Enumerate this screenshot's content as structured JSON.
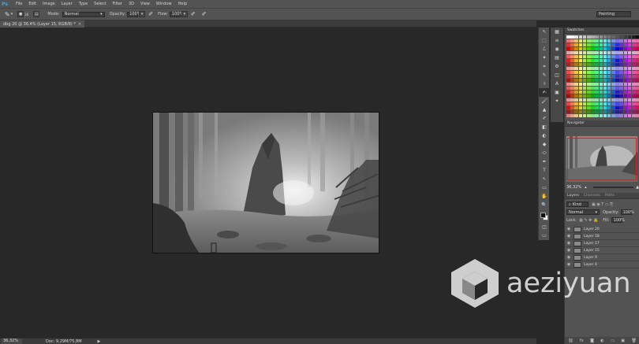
{
  "app": {
    "logo": "Ps"
  },
  "menu": [
    "File",
    "Edit",
    "Image",
    "Layer",
    "Type",
    "Select",
    "Filter",
    "3D",
    "View",
    "Window",
    "Help"
  ],
  "options": {
    "brush_size": "26",
    "mode_label": "Mode:",
    "mode_value": "Normal",
    "opacity_label": "Opacity:",
    "opacity_value": "100%",
    "flow_label": "Flow:",
    "flow_value": "100%"
  },
  "workspace": "Painting",
  "document_tab": {
    "title": "dbg 20 @ 36,4% (Layer 15, RGB/8) *",
    "close": "×"
  },
  "status": {
    "zoom": "36,32%",
    "doc": "Doc: 9,29M/75,8M",
    "arrow": "▶"
  },
  "tools": [
    "↖",
    "⬚",
    "ℒ",
    "✦",
    "⌗",
    "✎",
    "⚕",
    "✍",
    "🖌",
    "▲",
    "✐",
    "◧",
    "◐",
    "◆",
    "⬭",
    "✒",
    "T",
    "↖",
    "▭",
    "✋",
    "🔍"
  ],
  "strip_icons": [
    "▦",
    "≡",
    "◉",
    "▤",
    "⚙",
    "◫",
    "A",
    "▣",
    "✦"
  ],
  "panels": {
    "swatches_tab": "Swatches",
    "navigator_tab": "Navigator",
    "navigator_zoom": "36,32%",
    "layers_tab": "Layers",
    "channels_tab": "Channels",
    "paths_tab": "Paths",
    "kind": "Kind",
    "blend_mode": "Normal",
    "opacity_label": "Opacity:",
    "opacity_value": "100%",
    "lock_label": "Lock:",
    "fill_label": "Fill:",
    "fill_value": "100%"
  },
  "layers": [
    "Layer 20",
    "Layer 18",
    "Layer 17",
    "Layer 15",
    "Layer 9",
    "Layer 4"
  ],
  "watermark": "aeziyuan"
}
